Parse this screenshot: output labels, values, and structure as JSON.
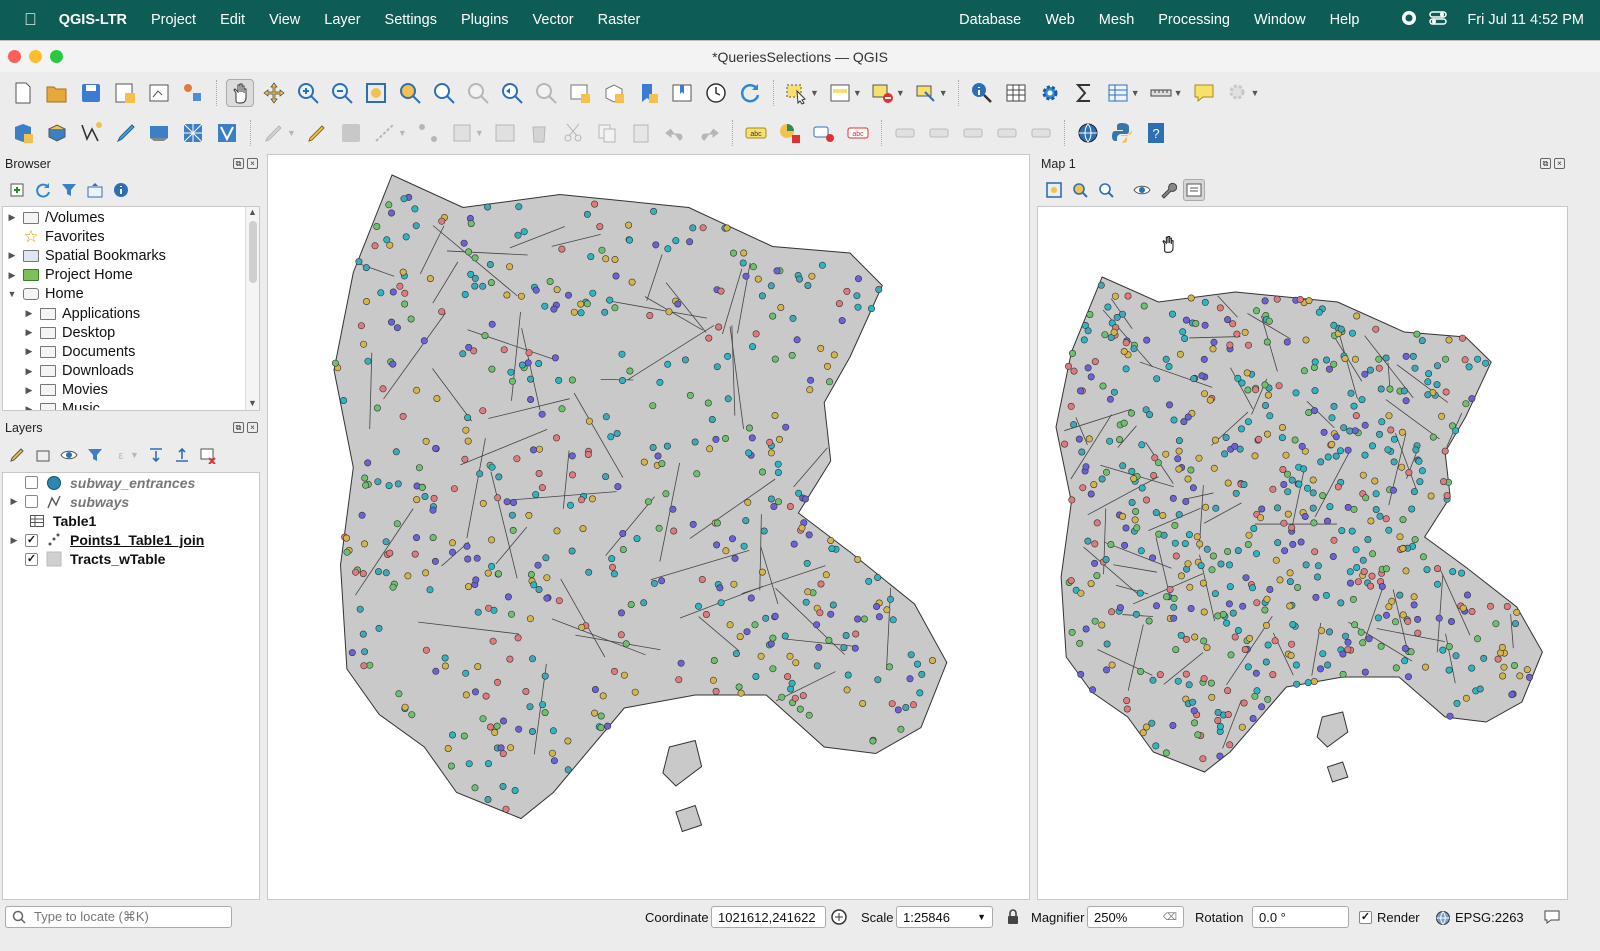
{
  "menubar": {
    "app": "QGIS-LTR",
    "items": [
      "Project",
      "Edit",
      "View",
      "Layer",
      "Settings",
      "Plugins",
      "Vector",
      "Raster"
    ],
    "right_items": [
      "Database",
      "Web",
      "Mesh",
      "Processing",
      "Window",
      "Help"
    ],
    "clock": "Fri Jul 11  4:52 PM"
  },
  "window": {
    "title": "*QueriesSelections — QGIS"
  },
  "browser": {
    "title": "Browser",
    "items": [
      {
        "label": "/Volumes",
        "icon": "folder-icon",
        "expand": "closed",
        "indent": 0
      },
      {
        "label": "Favorites",
        "icon": "star-icon",
        "expand": "none",
        "indent": 0
      },
      {
        "label": "Spatial Bookmarks",
        "icon": "bookmark-icon",
        "expand": "closed",
        "indent": 0
      },
      {
        "label": "Project Home",
        "icon": "project-home-icon",
        "expand": "closed",
        "indent": 0
      },
      {
        "label": "Home",
        "icon": "home-icon",
        "expand": "open",
        "indent": 0
      },
      {
        "label": "Applications",
        "icon": "folder-icon",
        "expand": "closed",
        "indent": 1
      },
      {
        "label": "Desktop",
        "icon": "folder-icon",
        "expand": "closed",
        "indent": 1
      },
      {
        "label": "Documents",
        "icon": "folder-icon",
        "expand": "closed",
        "indent": 1
      },
      {
        "label": "Downloads",
        "icon": "folder-icon",
        "expand": "closed",
        "indent": 1
      },
      {
        "label": "Movies",
        "icon": "folder-icon",
        "expand": "closed",
        "indent": 1
      },
      {
        "label": "Music",
        "icon": "folder-icon",
        "expand": "closed",
        "indent": 1
      }
    ]
  },
  "layers": {
    "title": "Layers",
    "items": [
      {
        "label": "subway_entrances",
        "checked": false,
        "italic": true,
        "bold": true,
        "icon": "point-layer-icon",
        "expand": "none"
      },
      {
        "label": "subways",
        "checked": false,
        "italic": true,
        "bold": true,
        "icon": "line-layer-icon",
        "expand": "closed"
      },
      {
        "label": "Table1",
        "checked": null,
        "italic": false,
        "bold": true,
        "icon": "table-icon",
        "expand": "none"
      },
      {
        "label": "Points1_Table1_join",
        "checked": true,
        "italic": false,
        "bold": true,
        "underline": true,
        "icon": "point-layer-icon",
        "expand": "closed"
      },
      {
        "label": "Tracts_wTable",
        "checked": true,
        "italic": false,
        "bold": true,
        "icon": "polygon-layer-icon",
        "expand": "none"
      }
    ]
  },
  "map1": {
    "title": "Map 1"
  },
  "status": {
    "locate_placeholder": "Type to locate (⌘K)",
    "coordinate_label": "Coordinate",
    "coordinate_value": "1021612,241622",
    "scale_label": "Scale",
    "scale_value": "1:25846",
    "magnifier_label": "Magnifier",
    "magnifier_value": "250%",
    "rotation_label": "Rotation",
    "rotation_value": "0.0 °",
    "render_label": "Render",
    "crs": "EPSG:2263"
  },
  "colors": {
    "menubar": "#0d5c55",
    "polygon_fill": "#c9c9c9",
    "point_colors": [
      "#2ab7c4",
      "#e17b7b",
      "#6cc26c",
      "#6a62d8",
      "#d5b54a",
      "#3fa8b8"
    ]
  }
}
